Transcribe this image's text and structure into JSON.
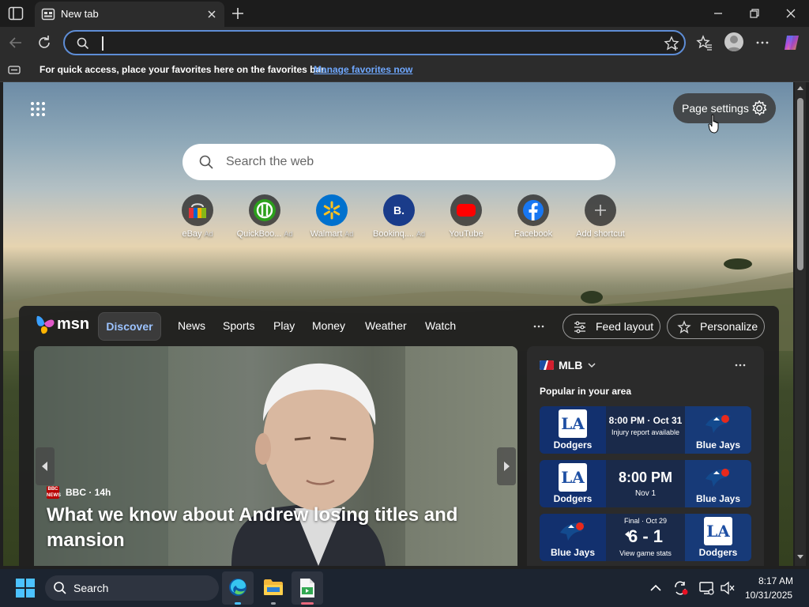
{
  "browser": {
    "tab_title": "New tab",
    "address_value": "",
    "favorites_bar_text": "For quick access, place your favorites here on the favorites bar.",
    "favorites_bar_link": "Manage favorites now"
  },
  "new_tab": {
    "page_settings_label": "Page settings",
    "search_placeholder": "Search the web",
    "shortcuts": [
      {
        "label": "eBay",
        "ad": "Ad",
        "icon": "ebay-icon"
      },
      {
        "label": "QuickBoo...",
        "ad": "Ad",
        "icon": "quickbooks-icon"
      },
      {
        "label": "Walmart",
        "ad": "Ad",
        "icon": "walmart-icon"
      },
      {
        "label": "Bookinq....",
        "ad": "Ad",
        "icon": "booking-icon"
      },
      {
        "label": "YouTube",
        "ad": "",
        "icon": "youtube-icon"
      },
      {
        "label": "Facebook",
        "ad": "",
        "icon": "facebook-icon"
      },
      {
        "label": "Add shortcut",
        "ad": "",
        "icon": "plus-icon"
      }
    ]
  },
  "feed": {
    "brand": "msn",
    "nav": [
      "Discover",
      "News",
      "Sports",
      "Play",
      "Money",
      "Weather",
      "Watch"
    ],
    "feed_layout_label": "Feed layout",
    "personalize_label": "Personalize",
    "hero": {
      "source_logo": "BBC NEWS",
      "source": "BBC · 14h",
      "headline": "What we know about Andrew losing titles and mansion"
    },
    "sports": {
      "league": "MLB",
      "subtitle": "Popular in your area",
      "games": [
        {
          "left_team": "Dodgers",
          "right_team": "Blue Jays",
          "line1": "8:00 PM · Oct 31",
          "line2": "Injury report available"
        },
        {
          "left_team": "Dodgers",
          "right_team": "Blue Jays",
          "line1": "8:00 PM",
          "line2": "Nov 1"
        },
        {
          "left_team": "Blue Jays",
          "right_team": "Dodgers",
          "status": "Final · Oct 29",
          "score": "6 - 1",
          "line2": "View game stats"
        }
      ]
    }
  },
  "taskbar": {
    "search_label": "Search",
    "time": "8:17 AM",
    "date": "10/31/2025"
  },
  "colors": {
    "accent": "#5e8dd6",
    "link": "#6fa8ff",
    "taskbar_bg": "#1c2430"
  }
}
